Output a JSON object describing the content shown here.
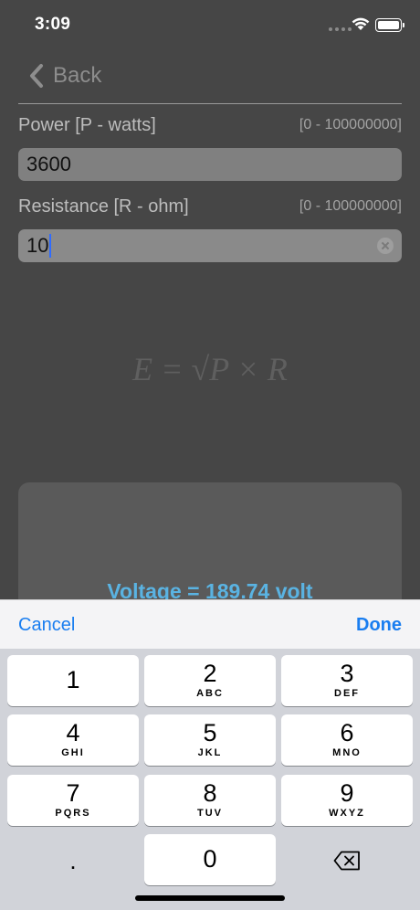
{
  "status": {
    "time": "3:09"
  },
  "nav": {
    "back_label": "Back"
  },
  "power": {
    "label": "Power [P - watts]",
    "range": "[0 - 100000000]",
    "value": "3600"
  },
  "resistance": {
    "label": "Resistance [R - ohm]",
    "range": "[0 - 100000000]",
    "value": "10"
  },
  "formula": "E = √P × R",
  "result": {
    "text": "Voltage = 189.74 volt"
  },
  "accessory": {
    "cancel": "Cancel",
    "done": "Done"
  },
  "keypad": {
    "k1": {
      "digit": "1",
      "letters": ""
    },
    "k2": {
      "digit": "2",
      "letters": "ABC"
    },
    "k3": {
      "digit": "3",
      "letters": "DEF"
    },
    "k4": {
      "digit": "4",
      "letters": "GHI"
    },
    "k5": {
      "digit": "5",
      "letters": "JKL"
    },
    "k6": {
      "digit": "6",
      "letters": "MNO"
    },
    "k7": {
      "digit": "7",
      "letters": "PQRS"
    },
    "k8": {
      "digit": "8",
      "letters": "TUV"
    },
    "k9": {
      "digit": "9",
      "letters": "WXYZ"
    },
    "k0": {
      "digit": "0"
    },
    "decimal": "."
  },
  "colors": {
    "accent": "#1a7ef0",
    "result": "#5ab3e2",
    "background": "#464646"
  },
  "icons": {
    "back": "chevron-left-icon",
    "clear": "clear-icon",
    "delete": "backspace-icon"
  }
}
